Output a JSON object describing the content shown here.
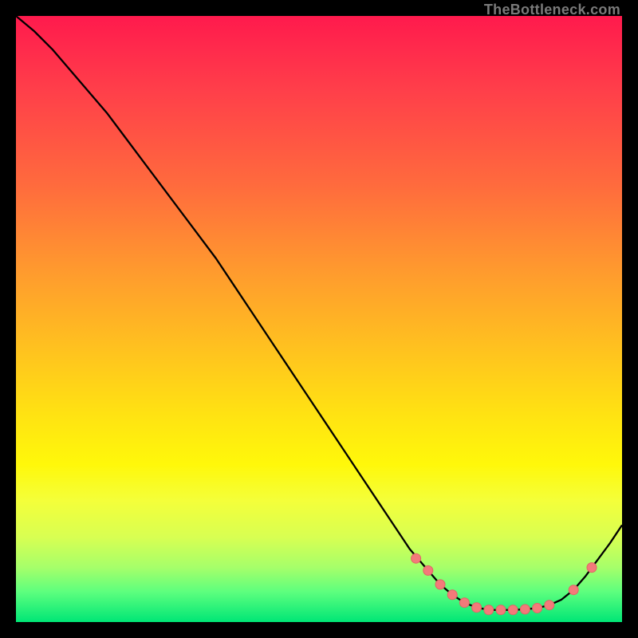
{
  "attribution": "TheBottleneck.com",
  "colors": {
    "curve": "#000000",
    "dot_fill": "#f37a7a",
    "dot_stroke": "#e16565"
  },
  "chart_data": {
    "type": "line",
    "title": "",
    "xlabel": "",
    "ylabel": "",
    "xlim": [
      0,
      100
    ],
    "ylim": [
      0,
      100
    ],
    "x": [
      0,
      3,
      6,
      9,
      12,
      15,
      18,
      21,
      24,
      27,
      30,
      33,
      36,
      39,
      42,
      45,
      48,
      51,
      54,
      57,
      60,
      63,
      65,
      68,
      70,
      72,
      74,
      76,
      78,
      80,
      82,
      84,
      86,
      88,
      90,
      92,
      94,
      96,
      98,
      100
    ],
    "values": [
      100,
      97.5,
      94.5,
      91.0,
      87.5,
      84.0,
      80.0,
      76.0,
      72.0,
      68.0,
      64.0,
      60.0,
      55.5,
      51.0,
      46.5,
      42.0,
      37.5,
      33.0,
      28.5,
      24.0,
      19.5,
      15.0,
      12.0,
      8.5,
      6.2,
      4.5,
      3.2,
      2.4,
      2.0,
      2.0,
      2.0,
      2.1,
      2.3,
      2.8,
      3.7,
      5.3,
      7.6,
      10.3,
      13.0,
      16.0
    ],
    "dots_x": [
      66,
      68,
      70,
      72,
      74,
      76,
      78,
      80,
      82,
      84,
      86,
      88,
      92,
      95
    ],
    "dots_y": [
      10.5,
      8.5,
      6.2,
      4.5,
      3.2,
      2.4,
      2.0,
      2.0,
      2.0,
      2.1,
      2.3,
      2.8,
      5.3,
      9.0
    ]
  }
}
